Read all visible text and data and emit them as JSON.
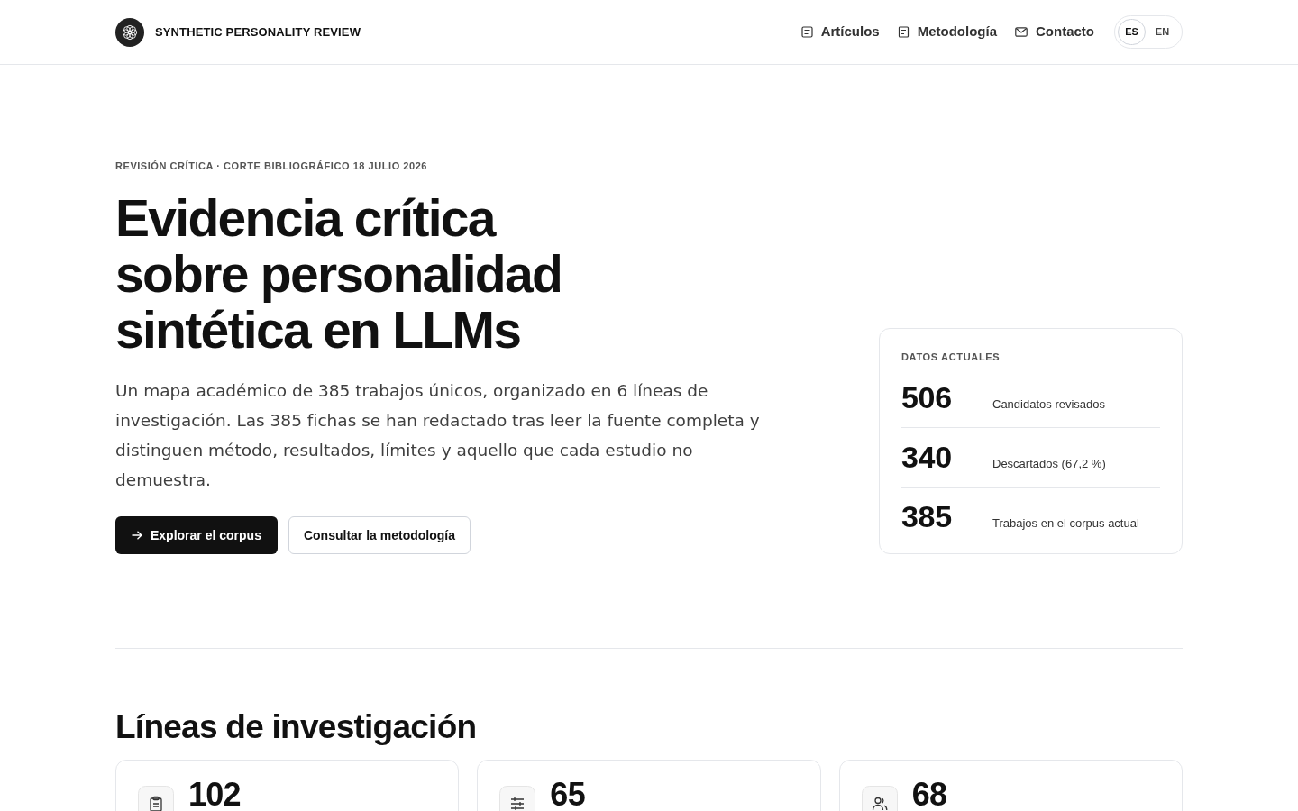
{
  "header": {
    "brand": "SYNTHETIC PERSONALITY REVIEW",
    "nav": [
      {
        "label": "Artículos"
      },
      {
        "label": "Metodología"
      },
      {
        "label": "Contacto"
      }
    ],
    "languages": [
      {
        "label": "ES",
        "selected": true
      },
      {
        "label": "EN",
        "selected": false
      }
    ]
  },
  "hero": {
    "eyebrow": "REVISIÓN CRÍTICA · CORTE BIBLIOGRÁFICO 18 JULIO 2026",
    "title": "Evidencia crítica sobre personalidad sintética en LLMs",
    "description": "Un mapa académico de 385 trabajos únicos, organizado en 6 líneas de investigación. Las 385 fichas se han redactado tras leer la fuente completa y distinguen método, resultados, límites y aquello que cada estudio no demuestra.",
    "buttons": [
      {
        "label": "Explorar el corpus",
        "kind": "primary"
      },
      {
        "label": "Consultar la metodología",
        "kind": "secondary"
      }
    ]
  },
  "stats": {
    "title": "DATOS ACTUALES",
    "items": [
      {
        "value": "506",
        "label": "Candidatos revisados"
      },
      {
        "value": "340",
        "label": "Descartados (67,2 %)"
      },
      {
        "value": "385",
        "label": "Trabajos en el corpus actual"
      }
    ]
  },
  "research_lines": {
    "title": "Líneas de investigación",
    "cards": [
      {
        "count": "102"
      },
      {
        "count": "65"
      },
      {
        "count": "68"
      }
    ]
  }
}
